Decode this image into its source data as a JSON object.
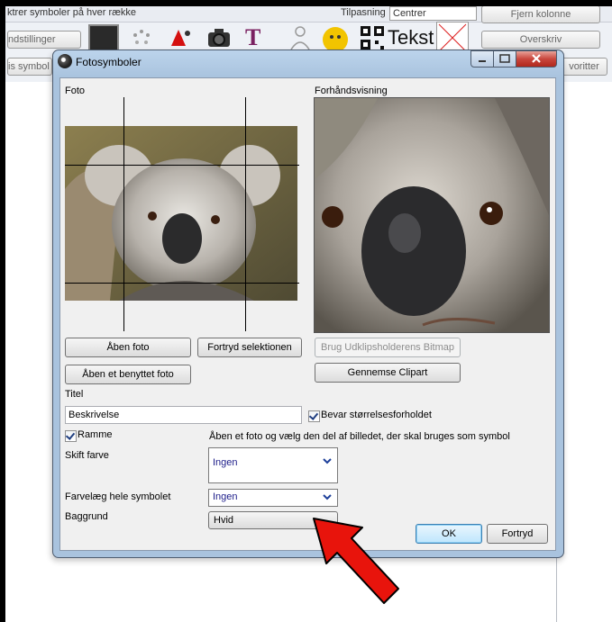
{
  "background": {
    "top_left_text": "ktrer symboler på hver række",
    "settings_label": "ndstillinger",
    "symbols_label": "is symbol",
    "fit_label": "Tilpasning",
    "fit_value": "Centrer",
    "remove_column": "Fjern kolonne",
    "overwrite": "Overskriv",
    "favorites": "voritter",
    "text_tool_label": "Tekst"
  },
  "dialog": {
    "title": "Fotosymboler",
    "photo_label": "Foto",
    "preview_label": "Forhåndsvisning",
    "open_photo": "Åben foto",
    "undo_selection": "Fortryd selektionen",
    "open_used_photo": "Åben et benyttet foto",
    "use_clipboard": "Brug Udklipsholderens Bitmap",
    "browse_clipart": "Gennemse Clipart",
    "title_label": "Titel",
    "title_value": "Beskrivelse",
    "keep_aspect": "Bevar størrelsesforholdet",
    "frame_label": "Ramme",
    "instruction": "Åben et foto og vælg den del af billedet, der skal bruges som symbol",
    "change_color_label": "Skift farve",
    "change_color_value": "Ingen",
    "colorize_label": "Farvelæg hele symbolet",
    "colorize_value": "Ingen",
    "background_label": "Baggrund",
    "background_value": "Hvid",
    "ok": "OK",
    "cancel": "Fortryd",
    "keep_aspect_checked": true,
    "frame_checked": true
  },
  "colors": {
    "arrow": "#e8140c",
    "title_bar": "#a9c3de",
    "close_button": "#c9463d"
  }
}
